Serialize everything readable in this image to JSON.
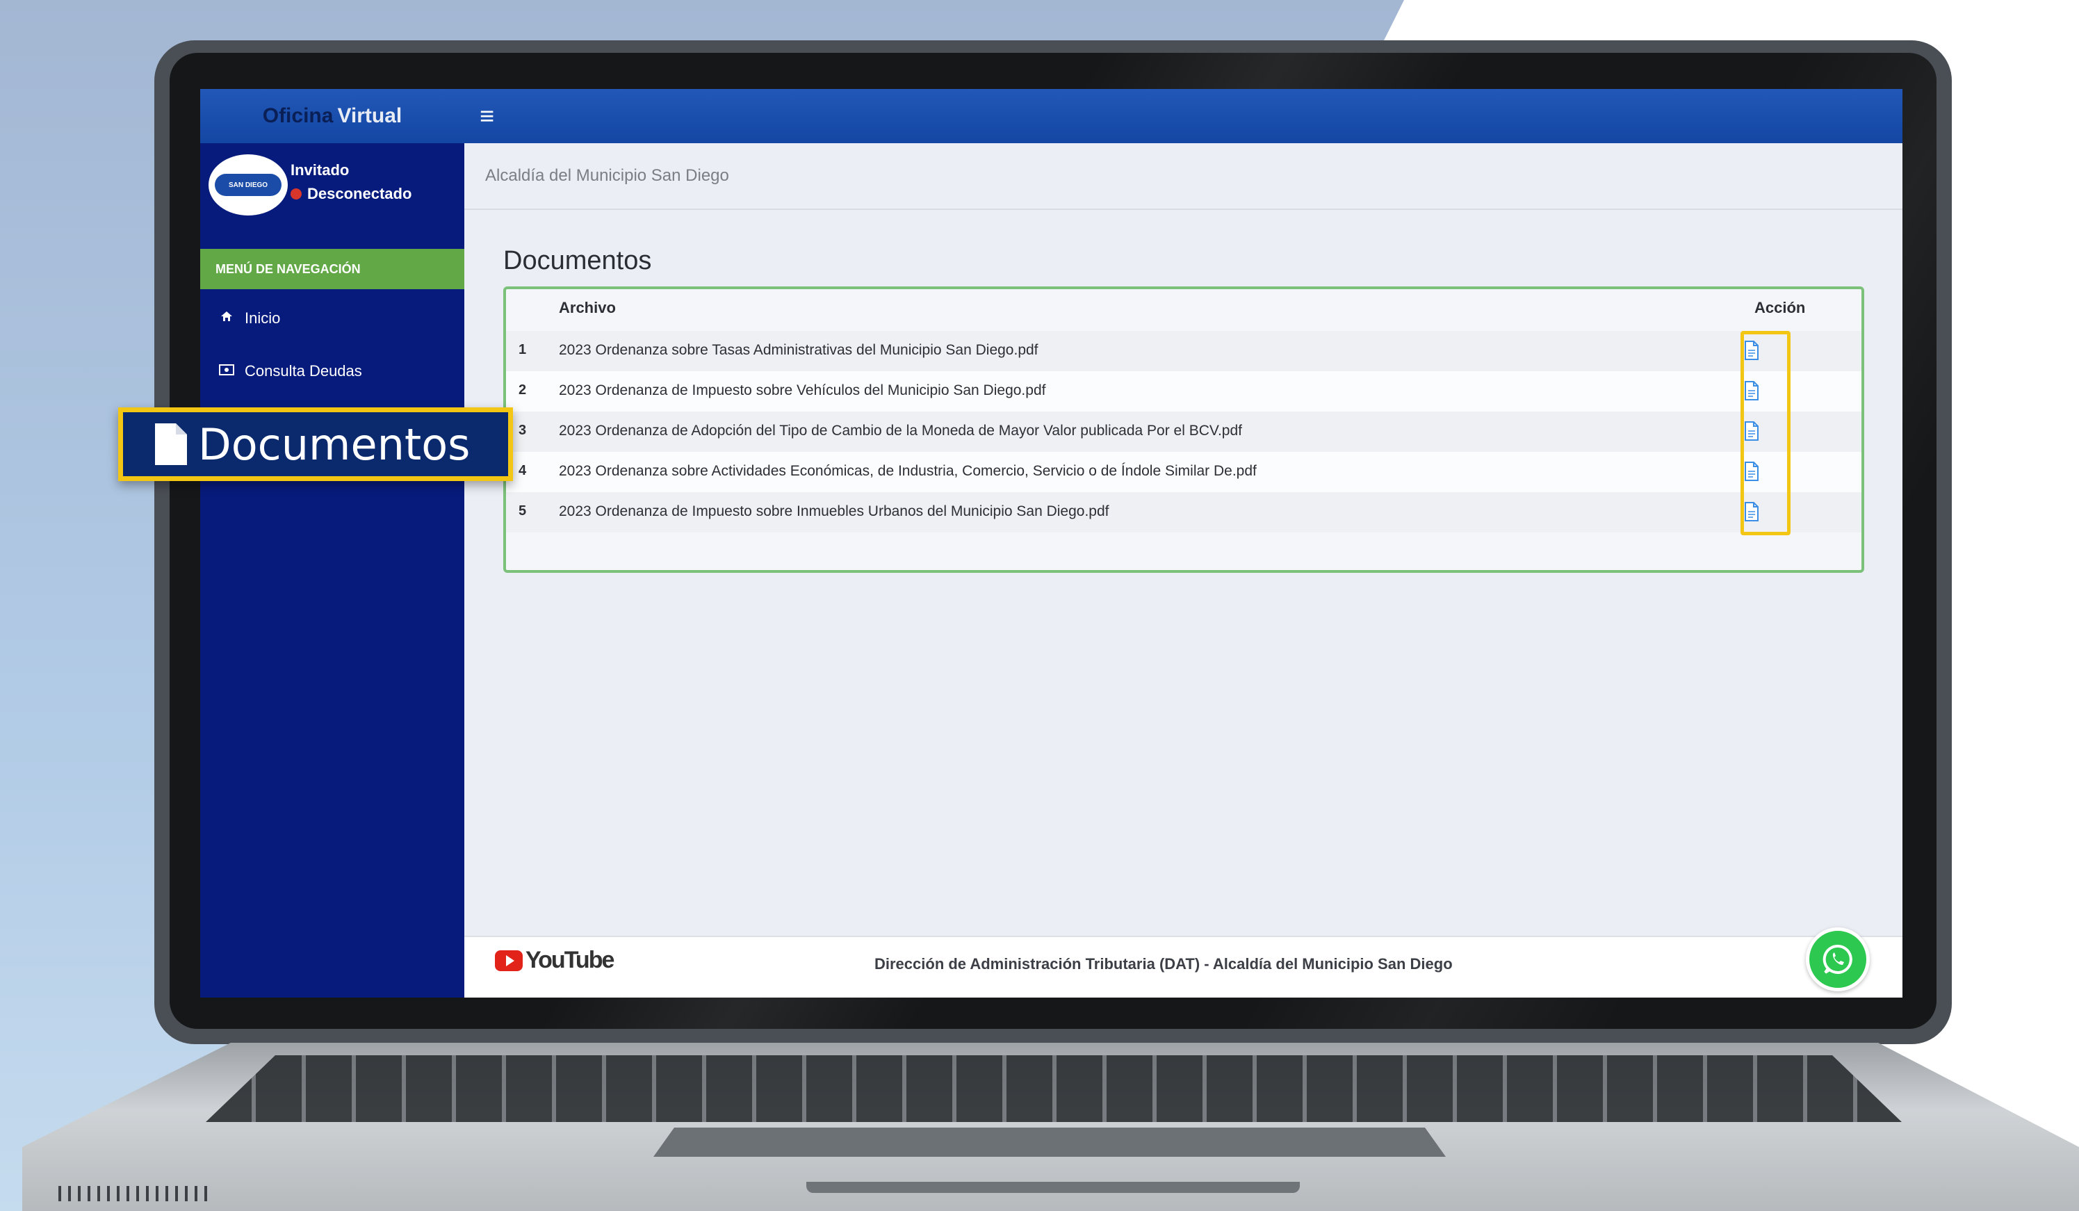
{
  "app": {
    "brand_part1": "Oficina",
    "brand_part2": "Virtual",
    "menu_icon": "≡"
  },
  "user": {
    "name": "Invitado",
    "status": "Desconectado",
    "status_color": "#d9362b"
  },
  "sidebar": {
    "header": "MENÚ DE NAVEGACIÓN",
    "items": [
      {
        "label": "Inicio",
        "icon": "home-icon"
      },
      {
        "label": "Consulta Deudas",
        "icon": "money-icon"
      }
    ]
  },
  "breadcrumb": "Alcaldía del Municipio San Diego",
  "page": {
    "title": "Documentos",
    "table": {
      "headers": {
        "file": "Archivo",
        "action": "Acción"
      },
      "rows": [
        {
          "n": "1",
          "file": "2023 Ordenanza sobre Tasas Administrativas del Municipio San Diego.pdf"
        },
        {
          "n": "2",
          "file": "2023 Ordenanza de Impuesto sobre Vehículos del Municipio San Diego.pdf"
        },
        {
          "n": "3",
          "file": "2023 Ordenanza de Adopción del Tipo de Cambio de la Moneda de Mayor Valor publicada Por el BCV.pdf"
        },
        {
          "n": "4",
          "file": "2023 Ordenanza sobre Actividades Económicas, de Industria, Comercio, Servicio o de Índole Similar De.pdf"
        },
        {
          "n": "5",
          "file": "2023 Ordenanza de Impuesto sobre Inmuebles Urbanos del Municipio San Diego.pdf"
        }
      ]
    }
  },
  "footer": {
    "youtube": "YouTube",
    "text": "Dirección de Administración Tributaria (DAT) - Alcaldía del Municipio San Diego"
  },
  "callout": {
    "label": "Documentos",
    "icon": "document-icon"
  },
  "colors": {
    "accent_green": "#62a846",
    "highlight": "#f2c612",
    "sidebar": "#071b7c",
    "topbar": "#1446a3"
  }
}
